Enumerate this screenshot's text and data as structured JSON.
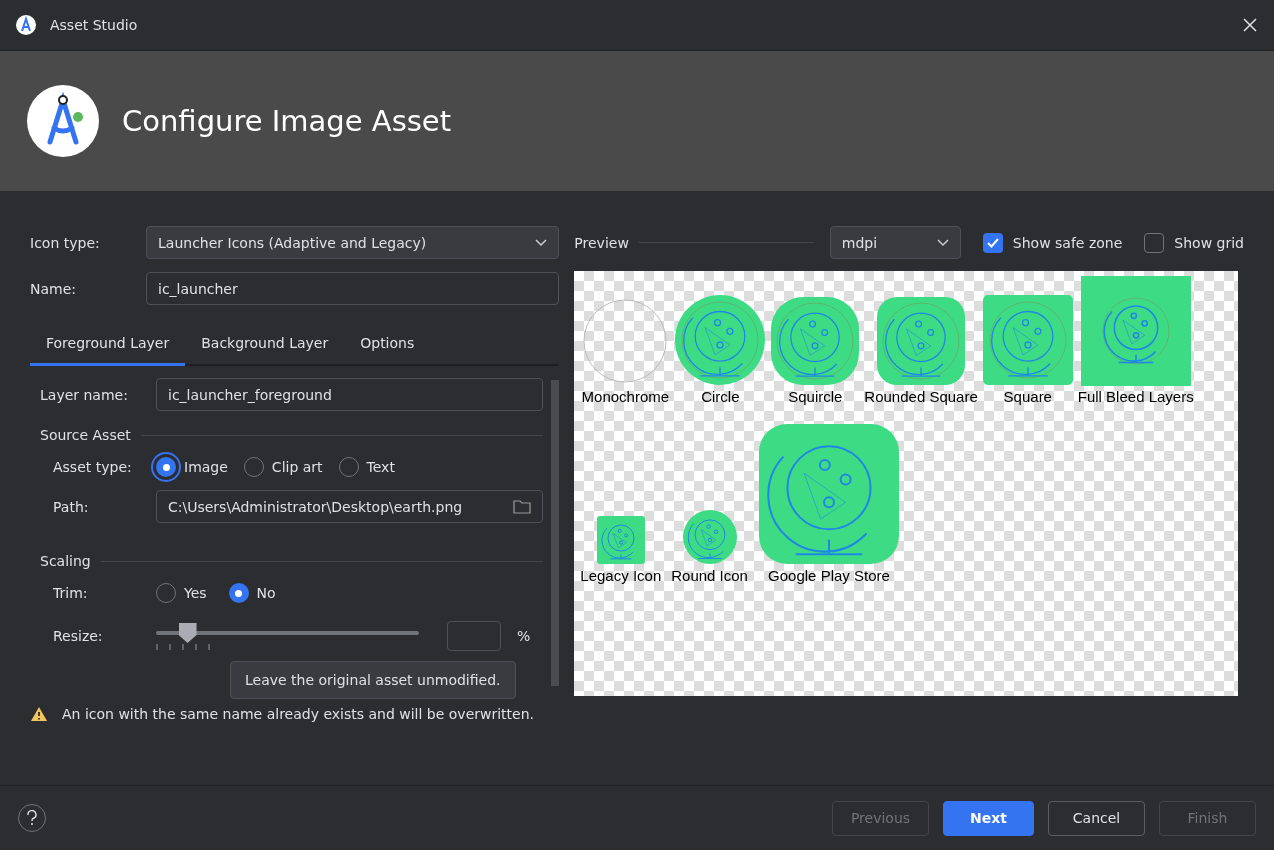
{
  "window": {
    "title": "Asset Studio"
  },
  "header": {
    "title": "Configure Image Asset"
  },
  "icon_type": {
    "label": "Icon type:",
    "value": "Launcher Icons (Adaptive and Legacy)"
  },
  "name": {
    "label": "Name:",
    "value": "ic_launcher"
  },
  "tabs": [
    {
      "label": "Foreground Layer",
      "selected": true
    },
    {
      "label": "Background Layer",
      "selected": false
    },
    {
      "label": "Options",
      "selected": false
    }
  ],
  "layer_name": {
    "label": "Layer name:",
    "value": "ic_launcher_foreground"
  },
  "source_asset": {
    "heading": "Source Asset",
    "asset_type_label": "Asset type:",
    "asset_types": [
      {
        "label": "Image",
        "selected": true
      },
      {
        "label": "Clip art",
        "selected": false
      },
      {
        "label": "Text",
        "selected": false
      }
    ],
    "path_label": "Path:",
    "path": "C:\\Users\\Administrator\\Desktop\\earth.png"
  },
  "scaling": {
    "heading": "Scaling",
    "trim_label": "Trim:",
    "trim_options": [
      {
        "label": "Yes",
        "selected": false
      },
      {
        "label": "No",
        "selected": true
      }
    ],
    "resize_label": "Resize:",
    "resize": {
      "level": 0.12
    },
    "unit": "%"
  },
  "tooltip": "Leave the original asset unmodified.",
  "warning": "An icon with the same name already exists and will be overwritten.",
  "preview": {
    "label": "Preview",
    "density": "mdpi",
    "show_safe_zone": {
      "label": "Show safe zone",
      "checked": true
    },
    "show_grid": {
      "label": "Show grid",
      "checked": false
    },
    "rows": [
      [
        {
          "label": "Monochrome",
          "kind": "monochrome"
        },
        {
          "label": "Circle",
          "kind": "circle"
        },
        {
          "label": "Squircle",
          "kind": "squircle"
        },
        {
          "label": "Rounded Square",
          "kind": "rounded"
        },
        {
          "label": "Square",
          "kind": "square"
        },
        {
          "label": "Full Bleed Layers",
          "kind": "fullbleed"
        }
      ],
      [
        {
          "label": "Legacy Icon",
          "kind": "legacy"
        },
        {
          "label": "Round Icon",
          "kind": "round"
        },
        {
          "label": "Google Play Store",
          "kind": "play"
        }
      ]
    ]
  },
  "buttons": [
    {
      "label": "Previous",
      "disabled": true,
      "primary": false
    },
    {
      "label": "Next",
      "disabled": false,
      "primary": true
    },
    {
      "label": "Cancel",
      "disabled": false,
      "primary": false
    },
    {
      "label": "Finish",
      "disabled": true,
      "primary": false
    }
  ]
}
